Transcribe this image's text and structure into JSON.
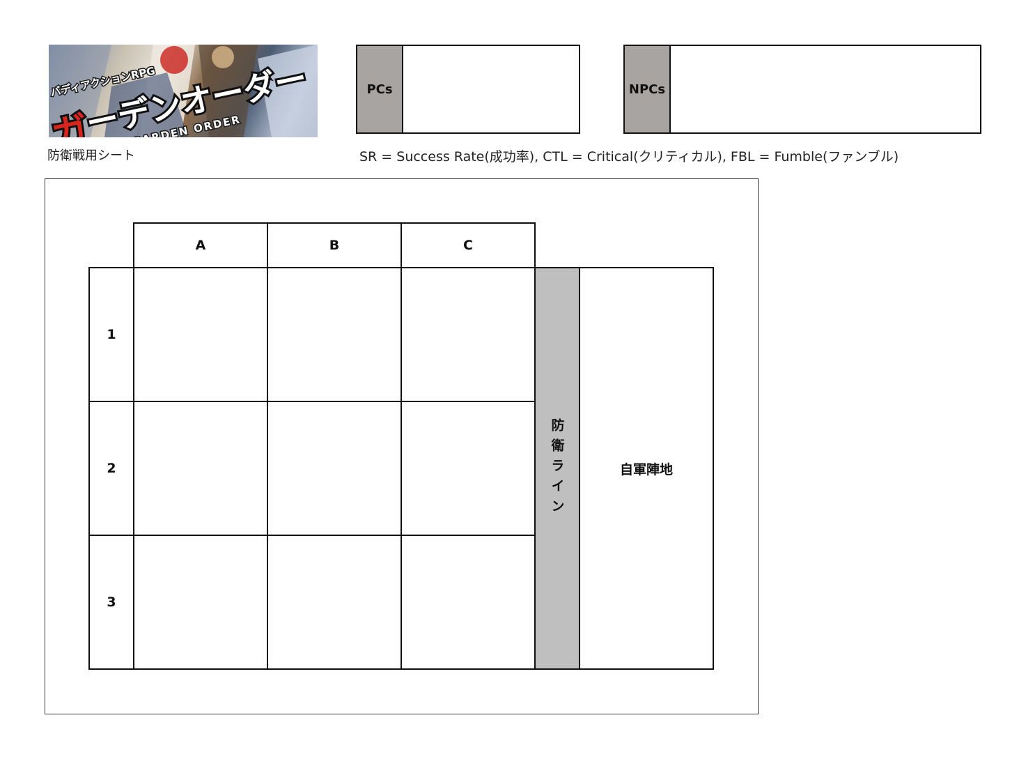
{
  "logo": {
    "subtitle": "バディアクションRPG",
    "title_red": "ガ",
    "title_rest": "ーデンオーダー",
    "english": "GARDEN ORDER"
  },
  "sheet_caption": "防衛戦用シート",
  "party": {
    "pcs_label": "PCs",
    "npcs_label": "NPCs"
  },
  "legend_note": "SR = Success Rate(成功率), CTL = Critical(クリティカル), FBL = Fumble(ファンブル)",
  "board": {
    "columns": [
      "A",
      "B",
      "C"
    ],
    "rows": [
      "1",
      "2",
      "3"
    ],
    "defense_line": "防衛ライン",
    "home_base": "自軍陣地"
  },
  "colors": {
    "party_label_bg": "#a8a4a2",
    "defense_line_bg": "#bfbfbf",
    "logo_red": "#d8261f"
  }
}
